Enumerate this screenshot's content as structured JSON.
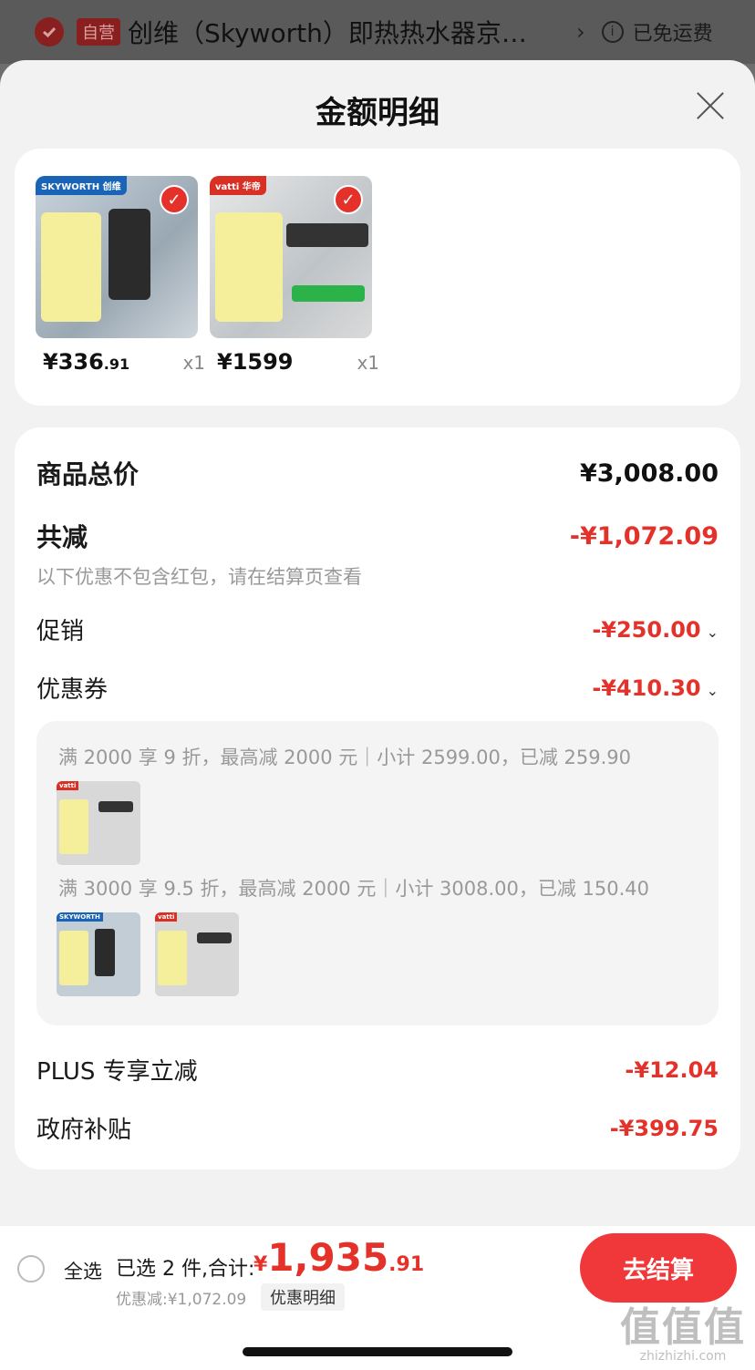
{
  "topbar": {
    "badge": "自营",
    "title": "创维（Skyworth）即热热水器京…",
    "chevron": "›",
    "info_icon": "i",
    "shipping": "已免运费"
  },
  "sheet": {
    "title": "金额明细"
  },
  "products": [
    {
      "brand": "SKYWORTH 创维",
      "price_int": "¥336",
      "price_dec": ".91",
      "qty": "x1"
    },
    {
      "brand": "vatti 华帝",
      "price_int": "¥1599",
      "price_dec": "",
      "qty": "x1"
    }
  ],
  "details": {
    "total_label": "商品总价",
    "total_value": "¥3,008.00",
    "reduce_label": "共减",
    "reduce_value": "-¥1,072.09",
    "reduce_note": "以下优惠不包含红包，请在结算页查看",
    "promo_label": "促销",
    "promo_value": "-¥250.00",
    "coupon_label": "优惠券",
    "coupon_value": "-¥410.30",
    "coupon_lines": [
      "满 2000 享 9 折，最高减 2000 元｜小计 2599.00，已减 259.90",
      "满 3000 享 9.5 折，最高减 2000 元｜小计 3008.00，已减 150.40"
    ],
    "plus_label": "PLUS 专享立减",
    "plus_value": "-¥12.04",
    "gov_label": "政府补贴",
    "gov_value": "-¥399.75"
  },
  "bottom": {
    "select_all": "全选",
    "selected_text": "已选 2 件,合计:",
    "total_symbol": "¥",
    "total_int": "1,935",
    "total_dec": ".91",
    "discount_text": "优惠减:¥1,072.09",
    "detail_link": "优惠明细",
    "checkout": "去结算"
  },
  "watermark": {
    "logo": "值值值",
    "url": "zhizhizhi.com"
  },
  "colors": {
    "accent": "#e4322b",
    "button": "#f0383a"
  }
}
